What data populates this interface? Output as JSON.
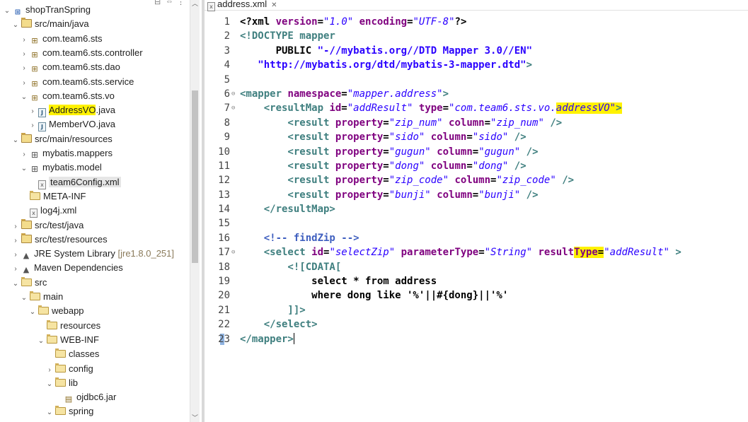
{
  "explorer": {
    "tree": [
      {
        "label": "shopTranSpring",
        "depth": 0,
        "expanded": true,
        "icon": "project-icon"
      },
      {
        "label": "src/main/java",
        "depth": 1,
        "expanded": true,
        "icon": "source-folder-icon"
      },
      {
        "label": "com.team6.sts",
        "depth": 2,
        "expanded": false,
        "icon": "package-icon"
      },
      {
        "label": "com.team6.sts.controller",
        "depth": 2,
        "expanded": false,
        "icon": "package-icon"
      },
      {
        "label": "com.team6.sts.dao",
        "depth": 2,
        "expanded": false,
        "icon": "package-icon"
      },
      {
        "label": "com.team6.sts.service",
        "depth": 2,
        "expanded": false,
        "icon": "package-icon"
      },
      {
        "label": "com.team6.sts.vo",
        "depth": 2,
        "expanded": true,
        "icon": "package-icon"
      },
      {
        "label": "AddressVO",
        "suffix": ".java",
        "depth": 3,
        "expanded": false,
        "icon": "java-file-icon",
        "highlight": true
      },
      {
        "label": "MemberVO.java",
        "depth": 3,
        "expanded": false,
        "icon": "java-file-icon"
      },
      {
        "label": "src/main/resources",
        "depth": 1,
        "expanded": true,
        "icon": "source-folder-icon"
      },
      {
        "label": "mybatis.mappers",
        "depth": 2,
        "expanded": false,
        "icon": "package-store-icon"
      },
      {
        "label": "mybatis.model",
        "depth": 2,
        "expanded": true,
        "icon": "package-store-icon"
      },
      {
        "label": "team6Config.xml",
        "depth": 3,
        "icon": "xml-file-icon",
        "selected": true
      },
      {
        "label": "META-INF",
        "depth": 2,
        "icon": "folder-icon"
      },
      {
        "label": "log4j.xml",
        "depth": 2,
        "icon": "xml-file-icon"
      },
      {
        "label": "src/test/java",
        "depth": 1,
        "expanded": false,
        "icon": "source-folder-icon"
      },
      {
        "label": "src/test/resources",
        "depth": 1,
        "expanded": false,
        "icon": "source-folder-icon"
      },
      {
        "label": "JRE System Library",
        "suffix_grey": "[jre1.8.0_251]",
        "depth": 1,
        "expanded": false,
        "icon": "library-icon"
      },
      {
        "label": "Maven Dependencies",
        "depth": 1,
        "expanded": false,
        "icon": "library-icon"
      },
      {
        "label": "src",
        "depth": 1,
        "expanded": true,
        "icon": "folder-icon"
      },
      {
        "label": "main",
        "depth": 2,
        "expanded": true,
        "icon": "folder-icon"
      },
      {
        "label": "webapp",
        "depth": 3,
        "expanded": true,
        "icon": "folder-icon"
      },
      {
        "label": "resources",
        "depth": 4,
        "icon": "folder-icon"
      },
      {
        "label": "WEB-INF",
        "depth": 4,
        "expanded": true,
        "icon": "folder-icon"
      },
      {
        "label": "classes",
        "depth": 5,
        "icon": "folder-icon"
      },
      {
        "label": "config",
        "depth": 5,
        "expanded": false,
        "icon": "folder-icon"
      },
      {
        "label": "lib",
        "depth": 5,
        "expanded": true,
        "icon": "folder-icon"
      },
      {
        "label": "ojdbc6.jar",
        "depth": 6,
        "icon": "jar-icon"
      },
      {
        "label": "spring",
        "depth": 5,
        "expanded": true,
        "icon": "folder-icon"
      }
    ]
  },
  "editor": {
    "tab_title": "address.xml",
    "lines": [
      {
        "n": "1",
        "fold": "",
        "tokens": [
          [
            "t-plain",
            "<?xml "
          ],
          [
            "t-attr",
            "version"
          ],
          [
            "t-plain",
            "="
          ],
          [
            "t-val",
            "\"1.0\""
          ],
          [
            "t-plain",
            " "
          ],
          [
            "t-attr",
            "encoding"
          ],
          [
            "t-plain",
            "="
          ],
          [
            "t-val",
            "\"UTF-8\""
          ],
          [
            "t-plain",
            "?>"
          ]
        ]
      },
      {
        "n": "2",
        "fold": "",
        "tokens": [
          [
            "t-tag",
            "<!DOCTYPE mapper"
          ]
        ]
      },
      {
        "n": "3",
        "fold": "",
        "tokens": [
          [
            "t-plain",
            "      PUBLIC "
          ],
          [
            "t-val-plain",
            "\"-//mybatis.org//DTD Mapper 3.0//EN\""
          ]
        ]
      },
      {
        "n": "4",
        "fold": "",
        "tokens": [
          [
            "t-val-plain",
            "   \"http://mybatis.org/dtd/mybatis-3-mapper.dtd\""
          ],
          [
            "t-tag",
            ">"
          ]
        ]
      },
      {
        "n": "5",
        "fold": "",
        "tokens": []
      },
      {
        "n": "6",
        "fold": "⊖",
        "tokens": [
          [
            "t-tag",
            "<mapper "
          ],
          [
            "t-attr",
            "namespace"
          ],
          [
            "t-plain",
            "="
          ],
          [
            "t-val",
            "\"mapper.address\""
          ],
          [
            "t-tag",
            ">"
          ]
        ]
      },
      {
        "n": "7",
        "fold": "⊖",
        "tokens": [
          [
            "t-tag",
            "    <resultMap "
          ],
          [
            "t-attr",
            "id"
          ],
          [
            "t-plain",
            "="
          ],
          [
            "t-val",
            "\"addResult\""
          ],
          [
            "t-plain",
            " "
          ],
          [
            "t-attr",
            "type"
          ],
          [
            "t-plain",
            "="
          ],
          [
            "t-val",
            "\"com.team6.sts.vo."
          ],
          [
            "t-val mark",
            "addressVO"
          ],
          [
            "t-val mark",
            "\""
          ],
          [
            "t-tag mark",
            ">"
          ]
        ]
      },
      {
        "n": "8",
        "fold": "",
        "tokens": [
          [
            "t-tag",
            "        <result "
          ],
          [
            "t-attr",
            "property"
          ],
          [
            "t-plain",
            "="
          ],
          [
            "t-val",
            "\"zip_num\""
          ],
          [
            "t-plain",
            " "
          ],
          [
            "t-attr",
            "column"
          ],
          [
            "t-plain",
            "="
          ],
          [
            "t-val",
            "\"zip_num\""
          ],
          [
            "t-tag",
            " />"
          ]
        ]
      },
      {
        "n": "9",
        "fold": "",
        "tokens": [
          [
            "t-tag",
            "        <result "
          ],
          [
            "t-attr",
            "property"
          ],
          [
            "t-plain",
            "="
          ],
          [
            "t-val",
            "\"sido\""
          ],
          [
            "t-plain",
            " "
          ],
          [
            "t-attr",
            "column"
          ],
          [
            "t-plain",
            "="
          ],
          [
            "t-val",
            "\"sido\""
          ],
          [
            "t-tag",
            " />"
          ]
        ]
      },
      {
        "n": "10",
        "fold": "",
        "tokens": [
          [
            "t-tag",
            "        <result "
          ],
          [
            "t-attr",
            "property"
          ],
          [
            "t-plain",
            "="
          ],
          [
            "t-val",
            "\"gugun\""
          ],
          [
            "t-plain",
            " "
          ],
          [
            "t-attr",
            "column"
          ],
          [
            "t-plain",
            "="
          ],
          [
            "t-val",
            "\"gugun\""
          ],
          [
            "t-tag",
            " />"
          ]
        ]
      },
      {
        "n": "11",
        "fold": "",
        "tokens": [
          [
            "t-tag",
            "        <result "
          ],
          [
            "t-attr",
            "property"
          ],
          [
            "t-plain",
            "="
          ],
          [
            "t-val",
            "\"dong\""
          ],
          [
            "t-plain",
            " "
          ],
          [
            "t-attr",
            "column"
          ],
          [
            "t-plain",
            "="
          ],
          [
            "t-val",
            "\"dong\""
          ],
          [
            "t-tag",
            " />"
          ]
        ]
      },
      {
        "n": "12",
        "fold": "",
        "tokens": [
          [
            "t-tag",
            "        <result "
          ],
          [
            "t-attr",
            "property"
          ],
          [
            "t-plain",
            "="
          ],
          [
            "t-val",
            "\"zip_code\""
          ],
          [
            "t-plain",
            " "
          ],
          [
            "t-attr",
            "column"
          ],
          [
            "t-plain",
            "="
          ],
          [
            "t-val",
            "\"zip_code\""
          ],
          [
            "t-tag",
            " />"
          ]
        ]
      },
      {
        "n": "13",
        "fold": "",
        "tokens": [
          [
            "t-tag",
            "        <result "
          ],
          [
            "t-attr",
            "property"
          ],
          [
            "t-plain",
            "="
          ],
          [
            "t-val",
            "\"bunji\""
          ],
          [
            "t-plain",
            " "
          ],
          [
            "t-attr",
            "column"
          ],
          [
            "t-plain",
            "="
          ],
          [
            "t-val",
            "\"bunji\""
          ],
          [
            "t-tag",
            " />"
          ]
        ]
      },
      {
        "n": "14",
        "fold": "",
        "tokens": [
          [
            "t-tag",
            "    </resultMap>"
          ]
        ]
      },
      {
        "n": "15",
        "fold": "",
        "tokens": []
      },
      {
        "n": "16",
        "fold": "",
        "tokens": [
          [
            "t-comment",
            "    <!-- findZip -->"
          ]
        ]
      },
      {
        "n": "17",
        "fold": "⊖",
        "tokens": [
          [
            "t-tag",
            "    <select "
          ],
          [
            "t-attr",
            "id"
          ],
          [
            "t-plain",
            "="
          ],
          [
            "t-val",
            "\"selectZip\""
          ],
          [
            "t-plain",
            " "
          ],
          [
            "t-attr",
            "parameterType"
          ],
          [
            "t-plain",
            "="
          ],
          [
            "t-val",
            "\"String\""
          ],
          [
            "t-plain",
            " "
          ],
          [
            "t-attr",
            "result"
          ],
          [
            "t-attr mark",
            "Type"
          ],
          [
            "t-plain mark",
            "="
          ],
          [
            "t-val",
            "\"addResult\""
          ],
          [
            "t-tag",
            " >"
          ]
        ]
      },
      {
        "n": "18",
        "fold": "",
        "tokens": [
          [
            "t-tag",
            "        <![CDATA["
          ]
        ]
      },
      {
        "n": "19",
        "fold": "",
        "tokens": [
          [
            "t-cdata",
            "            select * from address"
          ]
        ]
      },
      {
        "n": "20",
        "fold": "",
        "tokens": [
          [
            "t-cdata",
            "            where dong like '%'||#{dong}||'%'"
          ]
        ]
      },
      {
        "n": "21",
        "fold": "",
        "tokens": [
          [
            "t-tag",
            "        ]]>"
          ]
        ]
      },
      {
        "n": "22",
        "fold": "",
        "tokens": [
          [
            "t-tag",
            "    </select>"
          ]
        ]
      },
      {
        "n": "23",
        "fold": "",
        "tokens": [
          [
            "t-tag",
            "</mapper>"
          ]
        ],
        "cursor": true
      }
    ]
  }
}
